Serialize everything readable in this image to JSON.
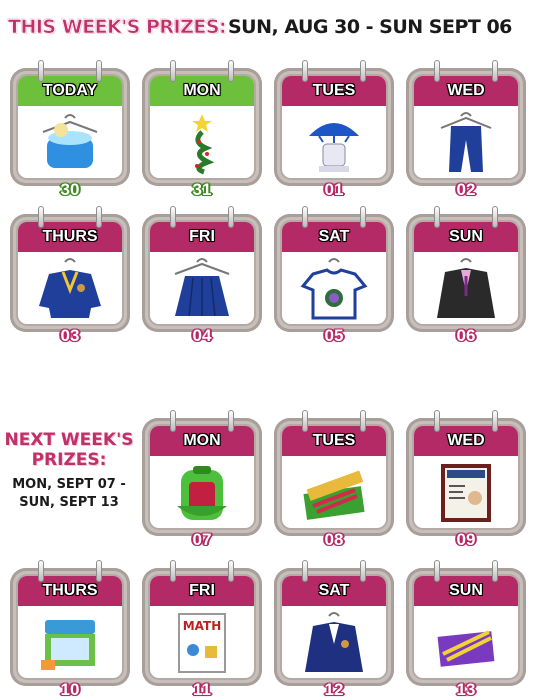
{
  "this_week": {
    "title": "THIS WEEK'S PRIZES:",
    "range": "SUN, AUG 30 - SUN SEPT 06",
    "days": [
      {
        "label": "TODAY",
        "date": "30",
        "icon": "hoodie-on-hanger-icon",
        "head_color": "green"
      },
      {
        "label": "MON",
        "date": "31",
        "icon": "christmas-tree-icon",
        "head_color": "green"
      },
      {
        "label": "TUES",
        "date": "01",
        "icon": "umbrella-gazebo-icon",
        "head_color": "pink"
      },
      {
        "label": "WED",
        "date": "02",
        "icon": "pants-on-hanger-icon",
        "head_color": "pink"
      },
      {
        "label": "THURS",
        "date": "03",
        "icon": "school-sweater-icon",
        "head_color": "pink"
      },
      {
        "label": "FRI",
        "date": "04",
        "icon": "pleated-skirt-icon",
        "head_color": "pink"
      },
      {
        "label": "SAT",
        "date": "05",
        "icon": "school-tshirt-icon",
        "head_color": "pink"
      },
      {
        "label": "SUN",
        "date": "06",
        "icon": "black-blazer-icon",
        "head_color": "pink"
      }
    ]
  },
  "next_week": {
    "title_line1": "NEXT WEEK'S",
    "title_line2": "PRIZES:",
    "range_line1": "MON, SEPT 07 -",
    "range_line2": "SUN, SEPT 13",
    "days": [
      {
        "label": "MON",
        "date": "07",
        "icon": "backpack-icon"
      },
      {
        "label": "TUES",
        "date": "08",
        "icon": "books-and-pencils-icon"
      },
      {
        "label": "WED",
        "date": "09",
        "icon": "language-poster-icon"
      },
      {
        "label": "THURS",
        "date": "10",
        "icon": "lunchbox-icon"
      },
      {
        "label": "FRI",
        "date": "11",
        "icon": "math-poster-icon"
      },
      {
        "label": "SAT",
        "date": "12",
        "icon": "navy-blazer-icon"
      },
      {
        "label": "SUN",
        "date": "13",
        "icon": "purple-notebook-icon"
      }
    ]
  },
  "colors": {
    "pink": "#b42a66",
    "green": "#6cc03c",
    "frame": "#c8beba"
  }
}
